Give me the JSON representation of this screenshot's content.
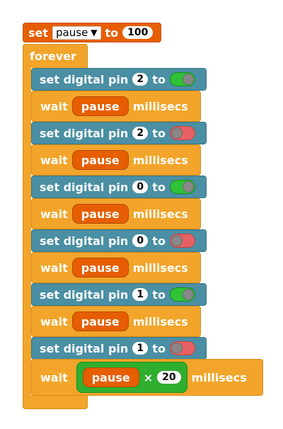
{
  "top_block": {
    "set_label": "set",
    "variable": "pause",
    "to_label": "to",
    "value": "100"
  },
  "forever_label": "forever",
  "steps": [
    {
      "type": "pin",
      "set_label": "set digital pin",
      "pin": "2",
      "to_label": "to",
      "state": "on"
    },
    {
      "type": "wait",
      "wait_label": "wait",
      "variable": "pause",
      "unit": "millisecs"
    },
    {
      "type": "pin",
      "set_label": "set digital pin",
      "pin": "2",
      "to_label": "to",
      "state": "off"
    },
    {
      "type": "wait",
      "wait_label": "wait",
      "variable": "pause",
      "unit": "millisecs"
    },
    {
      "type": "pin",
      "set_label": "set digital pin",
      "pin": "0",
      "to_label": "to",
      "state": "on"
    },
    {
      "type": "wait",
      "wait_label": "wait",
      "variable": "pause",
      "unit": "millisecs"
    },
    {
      "type": "pin",
      "set_label": "set digital pin",
      "pin": "0",
      "to_label": "to",
      "state": "off"
    },
    {
      "type": "wait",
      "wait_label": "wait",
      "variable": "pause",
      "unit": "millisecs"
    },
    {
      "type": "pin",
      "set_label": "set digital pin",
      "pin": "1",
      "to_label": "to",
      "state": "on"
    },
    {
      "type": "wait",
      "wait_label": "wait",
      "variable": "pause",
      "unit": "millisecs"
    },
    {
      "type": "pin",
      "set_label": "set digital pin",
      "pin": "1",
      "to_label": "to",
      "state": "off"
    }
  ],
  "last_wait": {
    "wait_label": "wait",
    "variable": "pause",
    "operator": "×",
    "factor": "20",
    "unit": "millisecs"
  },
  "colors": {
    "variable_block": "#e65e00",
    "control_block": "#f2a52a",
    "pin_block": "#4a8fa4",
    "math_block": "#2fae2f",
    "toggle_on": "#2fc136",
    "toggle_off": "#e76162"
  }
}
